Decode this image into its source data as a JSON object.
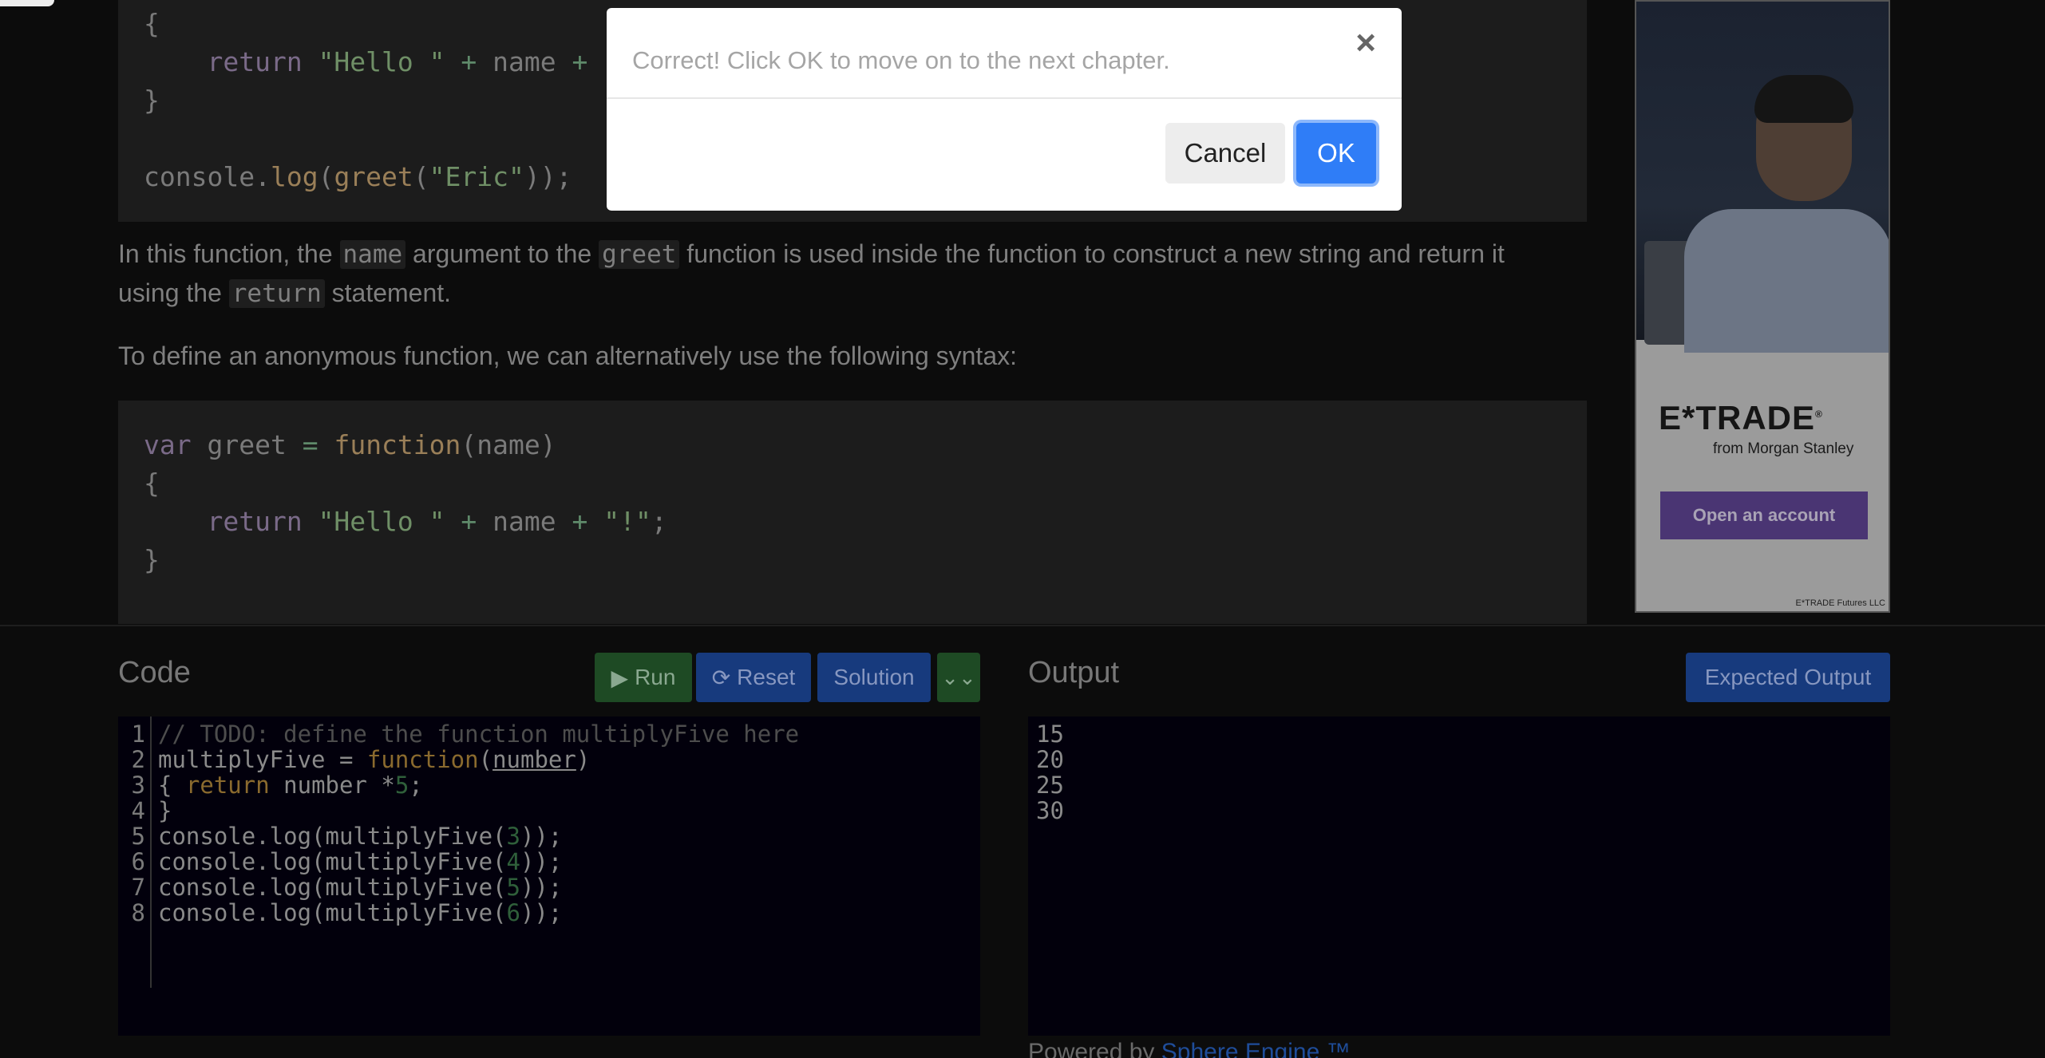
{
  "lesson": {
    "code_block_1": [
      {
        "parts": [
          [
            "plain",
            "{"
          ]
        ]
      },
      {
        "parts": [
          [
            "plain",
            "    "
          ],
          [
            "kw",
            "return "
          ],
          [
            "str",
            "\"Hello \""
          ],
          [
            "op",
            " + "
          ],
          [
            "plain",
            "name"
          ],
          [
            "op",
            " + "
          ],
          [
            "str",
            "\""
          ]
        ]
      },
      {
        "parts": [
          [
            "plain",
            "}"
          ]
        ]
      },
      {
        "parts": [
          [
            "plain",
            ""
          ]
        ]
      },
      {
        "parts": [
          [
            "plain",
            "console."
          ],
          [
            "mt",
            "log"
          ],
          [
            "plain",
            "("
          ],
          [
            "fn",
            "greet"
          ],
          [
            "plain",
            "("
          ],
          [
            "str",
            "\"Eric\""
          ],
          [
            "plain",
            "));"
          ]
        ]
      }
    ],
    "para1": {
      "t1": "In this function, the ",
      "c1": "name",
      "t2": " argument to the ",
      "c2": "greet",
      "t3": " function is used inside the function to construct a new string and return it",
      "t4": "using the ",
      "c3": "return",
      "t5": " statement."
    },
    "para2": "To define an anonymous function, we can alternatively use the following syntax:",
    "code_block_2": [
      {
        "parts": [
          [
            "kw",
            "var "
          ],
          [
            "plain",
            "greet "
          ],
          [
            "op",
            "= "
          ],
          [
            "fn",
            "function"
          ],
          [
            "plain",
            "(name)"
          ]
        ]
      },
      {
        "parts": [
          [
            "plain",
            "{"
          ]
        ]
      },
      {
        "parts": [
          [
            "plain",
            "    "
          ],
          [
            "kw",
            "return "
          ],
          [
            "str",
            "\"Hello \""
          ],
          [
            "op",
            " + "
          ],
          [
            "plain",
            "name"
          ],
          [
            "op",
            " + "
          ],
          [
            "str",
            "\"!\""
          ],
          [
            "plain",
            ";"
          ]
        ]
      },
      {
        "parts": [
          [
            "plain",
            "}"
          ]
        ]
      }
    ]
  },
  "ad": {
    "brand": "E*TRADE",
    "brand_mark": "®",
    "from": "from Morgan Stanley",
    "cta": "Open an account",
    "footer": "E*TRADE Futures LLC"
  },
  "code_panel": {
    "title": "Code",
    "run_label": "Run",
    "reset_label": "Reset",
    "solution_label": "Solution",
    "lines": [
      [
        [
          "comment",
          "// TODO: define the function multiplyFive here"
        ]
      ],
      [
        [
          "plain",
          "multiplyFive = "
        ],
        [
          "kw",
          "function"
        ],
        [
          "plain",
          "("
        ],
        [
          "ul",
          "number"
        ],
        [
          "plain",
          ")"
        ]
      ],
      [
        [
          "plain",
          "{ "
        ],
        [
          "kw",
          "return"
        ],
        [
          "plain",
          " number *"
        ],
        [
          "num",
          "5"
        ],
        [
          "plain",
          ";"
        ]
      ],
      [
        [
          "plain",
          "}"
        ]
      ],
      [
        [
          "plain",
          "console.log(multiplyFive("
        ],
        [
          "num",
          "3"
        ],
        [
          "plain",
          "));"
        ]
      ],
      [
        [
          "plain",
          "console.log(multiplyFive("
        ],
        [
          "num",
          "4"
        ],
        [
          "plain",
          "));"
        ]
      ],
      [
        [
          "plain",
          "console.log(multiplyFive("
        ],
        [
          "num",
          "5"
        ],
        [
          "plain",
          "));"
        ]
      ],
      [
        [
          "plain",
          "console.log(multiplyFive("
        ],
        [
          "num",
          "6"
        ],
        [
          "plain",
          "));"
        ]
      ]
    ]
  },
  "output_panel": {
    "title": "Output",
    "expected_label": "Expected Output",
    "lines": [
      "15",
      "20",
      "25",
      "30"
    ],
    "powered_prefix": "Powered by ",
    "powered_link": "Sphere Engine ™"
  },
  "modal": {
    "message": "Correct! Click OK to move on to the next chapter.",
    "close_glyph": "×",
    "cancel_label": "Cancel",
    "ok_label": "OK"
  }
}
